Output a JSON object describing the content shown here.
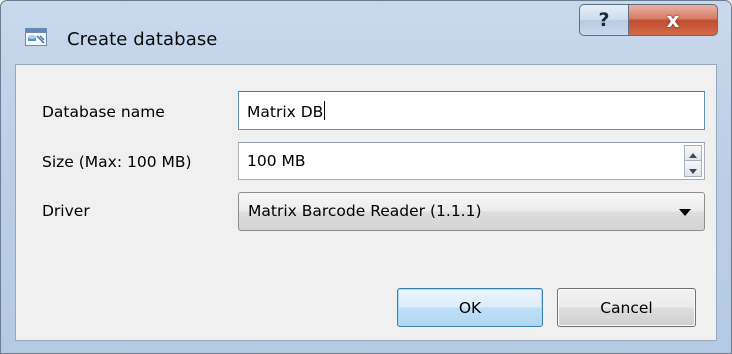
{
  "window": {
    "title": "Create database",
    "help_label": "?",
    "close_label": "x"
  },
  "form": {
    "name_label": "Database name",
    "name_value": "Matrix DB",
    "size_label": "Size (Max: 100 MB)",
    "size_value": "100 MB",
    "driver_label": "Driver",
    "driver_value": "Matrix Barcode Reader (1.1.1)"
  },
  "buttons": {
    "ok_label": "OK",
    "cancel_label": "Cancel"
  },
  "icons": {
    "app": "database-app-icon",
    "spin_up": "spin-up-icon",
    "spin_down": "spin-down-icon",
    "dropdown": "chevron-down-icon"
  },
  "colors": {
    "titlebar": "#bcd0e8",
    "close_button": "#c04e30",
    "default_button_border": "#3c7fb1",
    "focus_border": "#3d7bad"
  }
}
